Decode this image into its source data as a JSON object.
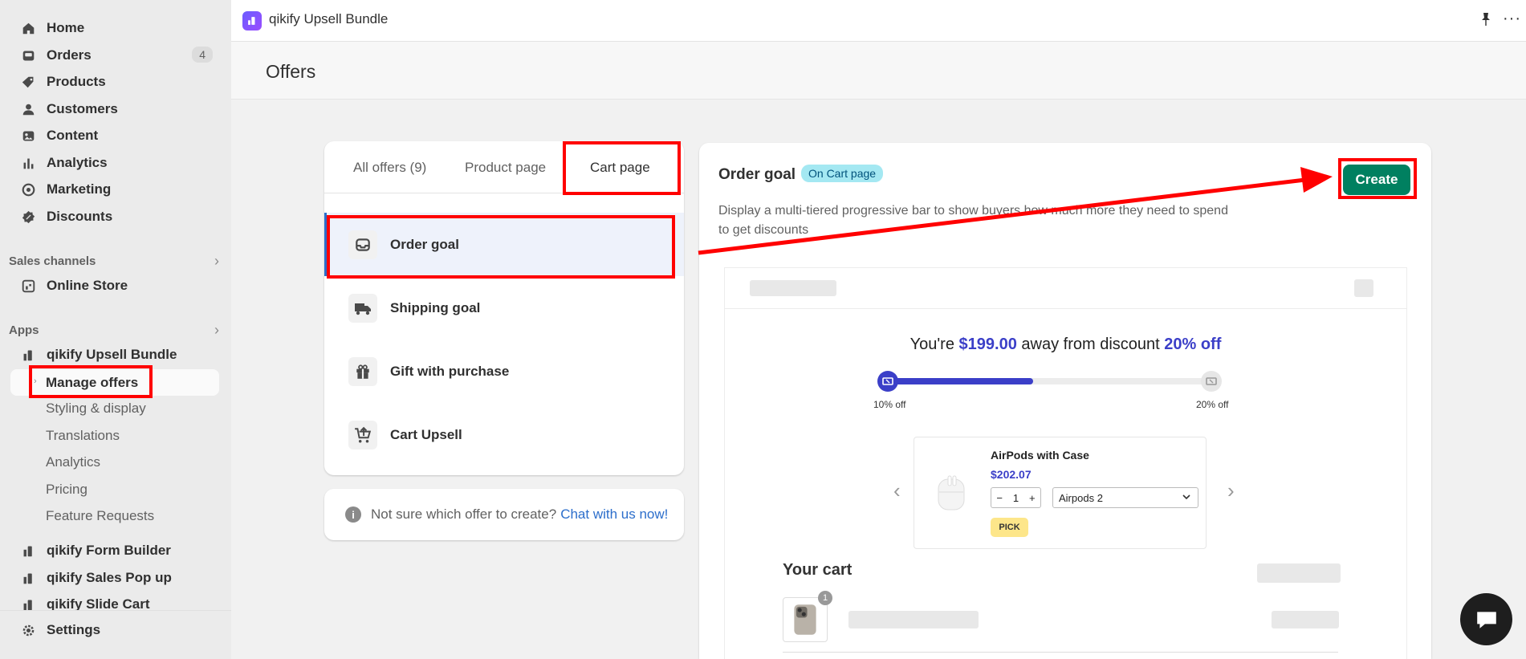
{
  "sidebar": {
    "items": [
      {
        "label": "Home",
        "icon": "home-icon"
      },
      {
        "label": "Orders",
        "icon": "orders-icon",
        "badge": "4"
      },
      {
        "label": "Products",
        "icon": "tag-icon"
      },
      {
        "label": "Customers",
        "icon": "person-icon"
      },
      {
        "label": "Content",
        "icon": "image-icon"
      },
      {
        "label": "Analytics",
        "icon": "bar-chart-icon"
      },
      {
        "label": "Marketing",
        "icon": "target-icon"
      },
      {
        "label": "Discounts",
        "icon": "discount-icon"
      }
    ],
    "sales_channels": {
      "heading": "Sales channels",
      "items": [
        {
          "label": "Online Store",
          "icon": "store-icon"
        }
      ]
    },
    "apps": {
      "heading": "Apps",
      "app_name": "qikify Upsell Bundle",
      "sub_items": [
        "Manage offers",
        "Styling & display",
        "Translations",
        "Analytics",
        "Pricing",
        "Feature Requests"
      ],
      "other_apps": [
        "qikify Form Builder",
        "qikify Sales Pop up",
        "qikify Slide Cart"
      ]
    },
    "settings_label": "Settings"
  },
  "topbar": {
    "app_title": "qikify Upsell Bundle"
  },
  "page": {
    "title": "Offers"
  },
  "tabs": [
    "All offers (9)",
    "Product page",
    "Cart page"
  ],
  "offers": [
    {
      "label": "Order goal",
      "icon": "inbox-icon"
    },
    {
      "label": "Shipping goal",
      "icon": "truck-icon"
    },
    {
      "label": "Gift with purchase",
      "icon": "gift-icon"
    },
    {
      "label": "Cart Upsell",
      "icon": "cart-upload-icon"
    }
  ],
  "help": {
    "text": "Not sure which offer to create?",
    "link": "Chat with us now!"
  },
  "detail": {
    "title": "Order goal",
    "badge": "On Cart page",
    "description": "Display a multi-tiered progressive bar to show buyers how much more they need to spend to get discounts",
    "create_label": "Create"
  },
  "preview": {
    "goal_prefix": "You're",
    "goal_amount": "$199.00",
    "goal_middle": "away from discount",
    "goal_discount": "20% off",
    "progress_fraction": 0.45,
    "tier_left": "10% off",
    "tier_right": "20% off",
    "product_name": "AirPods with Case",
    "product_price": "$202.07",
    "qty": "1",
    "variant": "Airpods 2",
    "pick_label": "PICK",
    "cart_heading": "Your cart",
    "cart_count": "1"
  },
  "colors": {
    "accent_green": "#008060",
    "highlight_red": "#ff0000",
    "preview_blue": "#3b3fc8"
  }
}
